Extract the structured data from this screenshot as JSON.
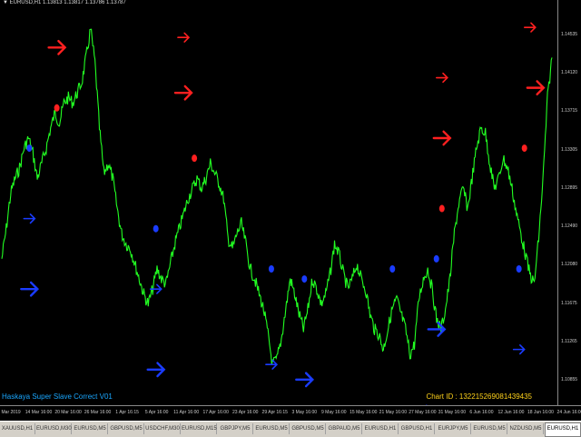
{
  "info_bar": {
    "symbol_line": "EURUSD,H1  1.13813 1.13817 1.13786 1.13787"
  },
  "price_axis": [
    "1.14535",
    "1.14120",
    "1.13715",
    "1.13305",
    "1.12895",
    "1.12490",
    "1.12080",
    "1.11675",
    "1.11265",
    "1.10855"
  ],
  "time_axis": [
    "8 Mar 2019",
    "14 Mar 16:00",
    "20 Mar 16:00",
    "26 Mar 16:00",
    "1 Apr 16:15",
    "5 Apr 16:00",
    "11 Apr 16:00",
    "17 Apr 16:00",
    "23 Apr 16:00",
    "29 Apr 16:15",
    "3 May 16:00",
    "9 May 16:00",
    "15 May 16:00",
    "21 May 16:00",
    "27 May 16:00",
    "31 May 16:00",
    "6 Jun 16:00",
    "12 Jun 16:00",
    "18 Jun 16:00",
    "24 Jun 16:00"
  ],
  "caption_left": "Haskaya Super Slave Correct V01",
  "caption_right": "Chart ID : 132215269081439435",
  "tabs": [
    "XAUUSD,H1",
    "EURUSD,M30",
    "EURUSD,M5",
    "GBPUSD,M5",
    "USDCHF,M30",
    "EURUSD,M15",
    "GBPJPY,M5",
    "EURUSD,M5",
    "GBPUSD,M5",
    "GBPAUD,M5",
    "EURUSD,H1",
    "GBPUSD,H1",
    "EURJPY,M5",
    "EURUSD,M5",
    "NZDUSD,M5",
    "EURUSD,H1"
  ],
  "active_tab_index": 15,
  "colors": {
    "price_line": "#22ff22",
    "buy_arrow": "#1a3cff",
    "sell_arrow": "#ff2020",
    "caption_left": "#1aa7ff",
    "caption_right": "#ffd21a"
  },
  "chart_data": {
    "type": "line",
    "series": [
      {
        "values": [
          1.122,
          1.125,
          1.1285,
          1.13,
          1.131,
          1.133,
          1.134,
          1.1325,
          1.13,
          1.1315,
          1.133,
          1.135,
          1.1365,
          1.1355,
          1.1375,
          1.138,
          1.1375,
          1.1385,
          1.1395,
          1.142,
          1.1448,
          1.1415,
          1.135,
          1.1305,
          1.1315,
          1.13,
          1.127,
          1.1245,
          1.1235,
          1.123,
          1.1215,
          1.12,
          1.1185,
          1.1175,
          1.119,
          1.121,
          1.12,
          1.1195,
          1.1215,
          1.1235,
          1.125,
          1.1265,
          1.128,
          1.129,
          1.13,
          1.129,
          1.13,
          1.1315,
          1.1305,
          1.1295,
          1.128,
          1.124,
          1.123,
          1.1245,
          1.1255,
          1.1235,
          1.121,
          1.12,
          1.1185,
          1.117,
          1.1145,
          1.1115,
          1.112,
          1.114,
          1.117,
          1.12,
          1.1185,
          1.1165,
          1.115,
          1.117,
          1.12,
          1.119,
          1.1175,
          1.1185,
          1.1205,
          1.1235,
          1.1225,
          1.1205,
          1.119,
          1.12,
          1.1215,
          1.12,
          1.119,
          1.1165,
          1.115,
          1.1145,
          1.113,
          1.115,
          1.117,
          1.118,
          1.1165,
          1.115,
          1.1125,
          1.1135,
          1.118,
          1.12,
          1.121,
          1.119,
          1.116,
          1.115,
          1.117,
          1.12,
          1.1245,
          1.1275,
          1.129,
          1.127,
          1.13,
          1.133,
          1.135,
          1.1345,
          1.1315,
          1.129,
          1.13,
          1.132,
          1.131,
          1.129,
          1.1265,
          1.1245,
          1.1225,
          1.1205,
          1.1195,
          1.124,
          1.13,
          1.138,
          1.142
        ]
      }
    ],
    "ylim": [
      1.108,
      1.147
    ],
    "sell_arrows": [
      [
        0.1,
        1.143
      ],
      [
        0.33,
        1.144
      ],
      [
        0.33,
        1.1385
      ],
      [
        0.8,
        1.14
      ],
      [
        0.8,
        1.134
      ],
      [
        0.96,
        1.145
      ],
      [
        0.97,
        1.139
      ]
    ],
    "buy_arrows": [
      [
        0.05,
        1.126
      ],
      [
        0.05,
        1.119
      ],
      [
        0.28,
        1.119
      ],
      [
        0.28,
        1.111
      ],
      [
        0.49,
        1.1115
      ],
      [
        0.55,
        1.11
      ],
      [
        0.77,
        1.107
      ],
      [
        0.79,
        1.115
      ],
      [
        0.94,
        1.113
      ]
    ],
    "sell_dots": [
      [
        0.1,
        1.137
      ],
      [
        0.35,
        1.132
      ],
      [
        0.8,
        1.127
      ],
      [
        0.95,
        1.133
      ]
    ],
    "buy_dots": [
      [
        0.05,
        1.133
      ],
      [
        0.28,
        1.125
      ],
      [
        0.49,
        1.121
      ],
      [
        0.55,
        1.12
      ],
      [
        0.71,
        1.121
      ],
      [
        0.79,
        1.122
      ],
      [
        0.94,
        1.121
      ]
    ]
  }
}
